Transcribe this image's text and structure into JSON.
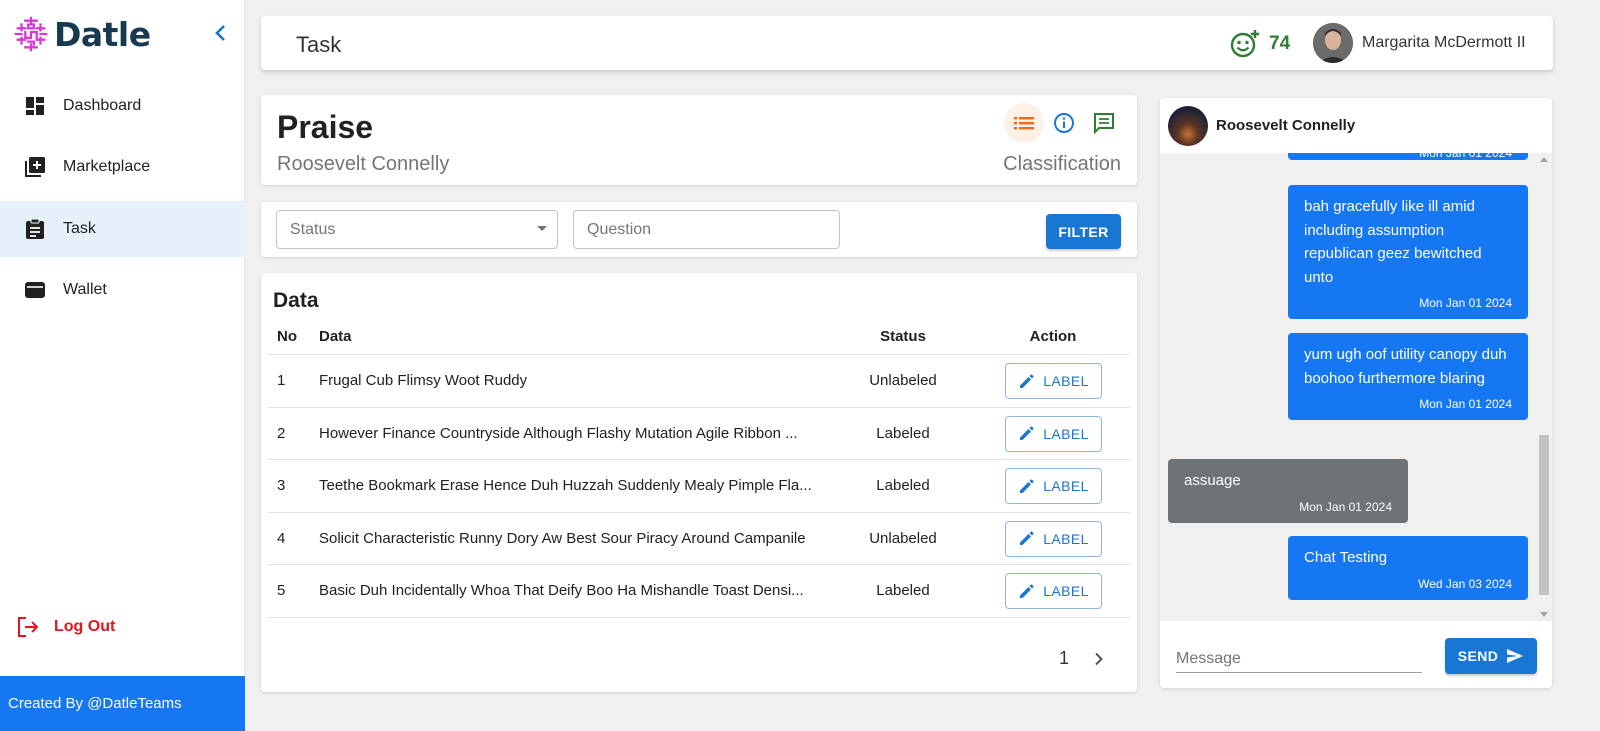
{
  "brand": {
    "name": "Datle",
    "accent": "#173a4f",
    "logo_color": "#d63ad6"
  },
  "sidebar": {
    "items": [
      {
        "key": "dashboard",
        "label": "Dashboard",
        "icon": "dashboard-icon",
        "active": false
      },
      {
        "key": "marketplace",
        "label": "Marketplace",
        "icon": "add-box-icon",
        "active": false
      },
      {
        "key": "task",
        "label": "Task",
        "icon": "clipboard-icon",
        "active": true
      },
      {
        "key": "wallet",
        "label": "Wallet",
        "icon": "wallet-icon",
        "active": false
      }
    ],
    "logout_label": "Log Out",
    "footer_text": "Created By @DatleTeams",
    "colors": {
      "footer": "#1677f2",
      "logout": "#e8141c",
      "active_bg": "#e6f0fa"
    }
  },
  "header": {
    "title": "Task",
    "points": "74",
    "user_name": "Margarita McDermott II"
  },
  "task": {
    "title": "Praise",
    "owner": "Roosevelt Connelly",
    "type": "Classification"
  },
  "filter": {
    "status_placeholder": "Status",
    "question_placeholder": "Question",
    "button_label": "FILTER"
  },
  "data_table": {
    "title": "Data",
    "columns": {
      "no": "No",
      "data": "Data",
      "status": "Status",
      "action": "Action"
    },
    "action_label": "LABEL",
    "rows": [
      {
        "no": "1",
        "data": "Frugal Cub Flimsy Woot Ruddy",
        "status": "Unlabeled"
      },
      {
        "no": "2",
        "data": "However Finance Countryside Although Flashy Mutation Agile Ribbon ...",
        "status": "Labeled"
      },
      {
        "no": "3",
        "data": "Teethe Bookmark Erase Hence Duh Huzzah Suddenly Mealy Pimple Fla...",
        "status": "Labeled"
      },
      {
        "no": "4",
        "data": "Solicit Characteristic Runny Dory Aw Best Sour Piracy Around Campanile",
        "status": "Unlabeled"
      },
      {
        "no": "5",
        "data": "Basic Duh Incidentally Whoa That Deify Boo Ha Mishandle Toast Densi...",
        "status": "Labeled"
      }
    ],
    "page": "1"
  },
  "chat": {
    "contact_name": "Roosevelt Connelly",
    "messages": [
      {
        "direction": "out",
        "text": "",
        "time": "Mon Jan 01 2024"
      },
      {
        "direction": "out",
        "text": "bah gracefully like ill amid including assumption republican geez bewitched unto",
        "time": "Mon Jan 01 2024"
      },
      {
        "direction": "out",
        "text": "yum ugh oof utility canopy duh boohoo furthermore blaring",
        "time": "Mon Jan 01 2024"
      },
      {
        "direction": "in",
        "text": "assuage",
        "time": "Mon Jan 01 2024"
      },
      {
        "direction": "out",
        "text": "Chat Testing",
        "time": "Wed Jan 03 2024"
      }
    ],
    "input_placeholder": "Message",
    "send_label": "SEND",
    "colors": {
      "outgoing": "#1677f2",
      "incoming": "#6e7377"
    }
  }
}
